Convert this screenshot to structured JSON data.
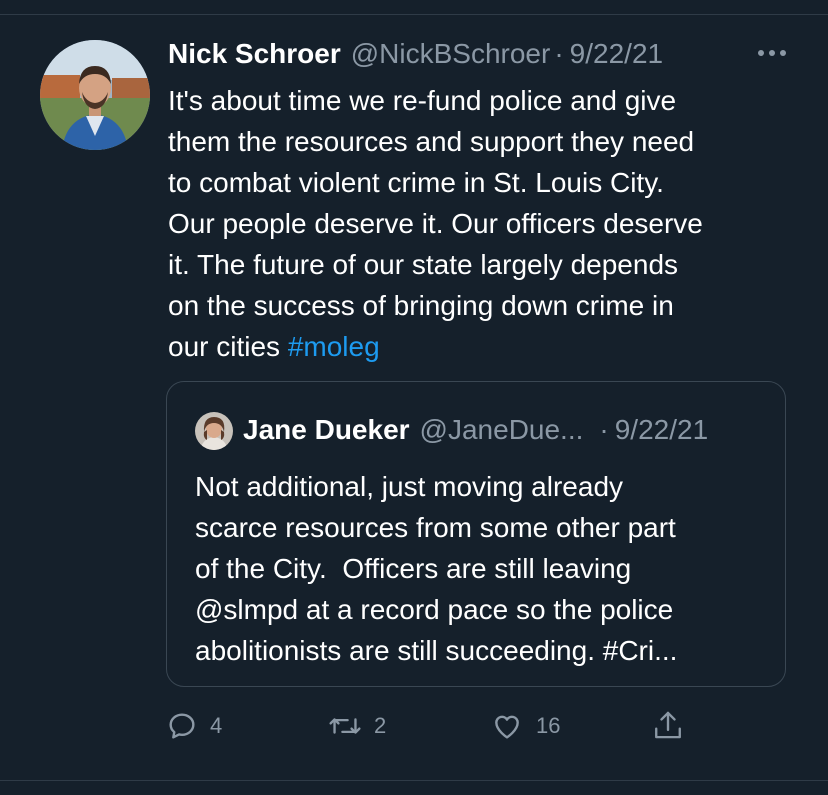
{
  "tweet": {
    "author": {
      "name": "Nick Schroer",
      "handle": "@NickBSchroer",
      "avatar": "profile-photo"
    },
    "separator": "·",
    "date": "9/22/21",
    "more_icon": "more-dots-icon",
    "text_lines": [
      "It's about time we re-fund police and give",
      "them the resources and support they need",
      "to combat violent crime in St. Louis City.",
      "Our people deserve it. Our officers deserve",
      "it. The future of our state largely depends",
      "on the success of bringing down crime in",
      "our cities "
    ],
    "hashtag": "#moleg",
    "quoted": {
      "author": {
        "name": "Jane Dueker",
        "handle": "@JaneDue...",
        "avatar": "profile-photo"
      },
      "separator": "·",
      "date": "9/22/21",
      "text_lines": [
        "Not additional, just moving already",
        "scarce resources from some other part",
        "of the City.  Officers are still leaving",
        "@slmpd at a record pace so the police",
        "abolitionists are still succeeding. #Cri..."
      ]
    },
    "actions": {
      "reply": {
        "icon": "reply-icon",
        "count": "4"
      },
      "retweet": {
        "icon": "retweet-icon",
        "count": "2"
      },
      "like": {
        "icon": "heart-icon",
        "count": "16"
      },
      "share": {
        "icon": "share-icon"
      }
    }
  },
  "colors": {
    "background": "#15202b",
    "text": "#ffffff",
    "secondary": "#8b98a5",
    "link": "#1d9bf0",
    "border": "#3a4753"
  }
}
